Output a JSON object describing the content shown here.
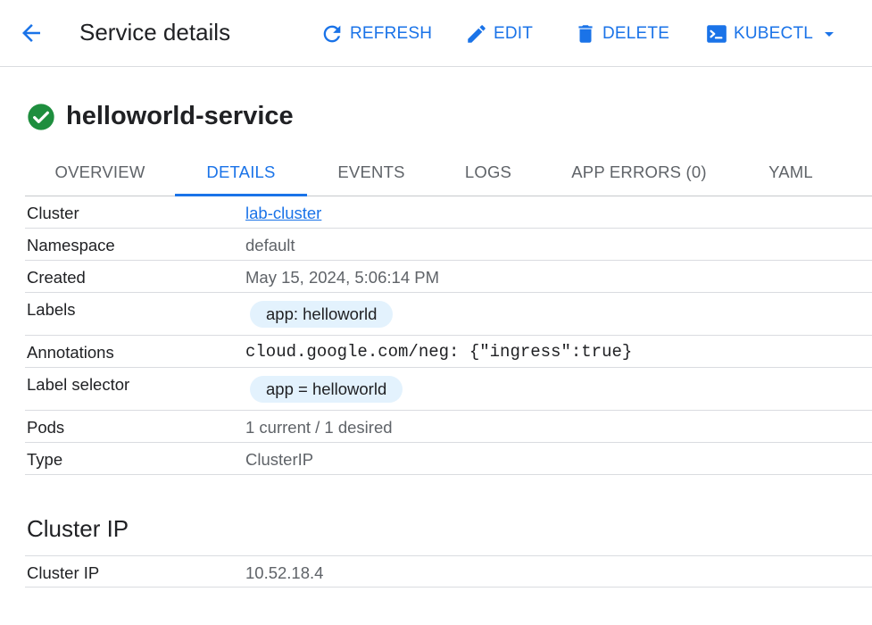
{
  "header": {
    "title": "Service details",
    "actions": {
      "refresh": "REFRESH",
      "edit": "EDIT",
      "delete": "DELETE",
      "kubectl": "KUBECTL"
    }
  },
  "service": {
    "name": "helloworld-service",
    "status": "ok"
  },
  "tabs": [
    {
      "label": "OVERVIEW"
    },
    {
      "label": "DETAILS",
      "active": true
    },
    {
      "label": "EVENTS"
    },
    {
      "label": "LOGS"
    },
    {
      "label": "APP ERRORS (0)"
    },
    {
      "label": "YAML"
    }
  ],
  "details": {
    "cluster": {
      "label": "Cluster",
      "value": "lab-cluster"
    },
    "namespace": {
      "label": "Namespace",
      "value": "default"
    },
    "created": {
      "label": "Created",
      "value": "May 15, 2024, 5:06:14 PM"
    },
    "labels": {
      "label": "Labels",
      "chip": "app: helloworld"
    },
    "annotations": {
      "label": "Annotations",
      "value": "cloud.google.com/neg: {\"ingress\":true}"
    },
    "label_selector": {
      "label": "Label selector",
      "chip": "app = helloworld"
    },
    "pods": {
      "label": "Pods",
      "value": "1 current / 1 desired"
    },
    "type": {
      "label": "Type",
      "value": "ClusterIP"
    }
  },
  "cluster_ip_section": {
    "title": "Cluster IP",
    "row": {
      "label": "Cluster IP",
      "value": "10.52.18.4"
    }
  },
  "colors": {
    "accent": "#1a73e8",
    "status_ok": "#1e8e3e",
    "chip_bg": "#e3f2fd"
  },
  "icons": {
    "back": "arrow-back-icon",
    "refresh": "refresh-icon",
    "edit": "pencil-icon",
    "delete": "trash-icon",
    "kubectl": "terminal-icon",
    "dropdown": "caret-down-icon",
    "status": "check-circle-icon"
  }
}
